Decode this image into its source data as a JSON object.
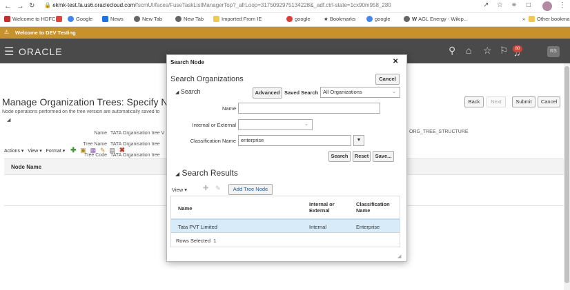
{
  "browser": {
    "url_host": "ekmk-test.fa.us6.oraclecloud.com",
    "url_path": "/fscmUI/faces/FuseTaskListManagerTop?_afrLoop=317509297513422​8&_adf.ctrl-state=1cx90m958_280",
    "bookmarks": [
      "Welcome to HDFC...",
      "Gmail",
      "Google",
      "News",
      "New Tab",
      "New Tab",
      "Imported From IE",
      "google",
      "Bookmarks",
      "google",
      "AGL Energy - Wikip..."
    ],
    "other_bookmarks": "Other bookmarks",
    "overflow": "»"
  },
  "dev_banner": "Welcome to DEV Testing",
  "oracle": {
    "logo": "ORACLE",
    "notification_count": "80",
    "user_initials": "RS"
  },
  "page": {
    "title": "Manage Organization Trees: Specify Nodes",
    "subtitle": "Node operations performed on the tree version are automatically saved to",
    "fields": [
      {
        "label": "Name",
        "value": "TATA Organisation tree V"
      },
      {
        "label": "Tree Name",
        "value": "TATA Organisation tree"
      },
      {
        "label": "Tree Code",
        "value": "TATA Organisation tree"
      }
    ],
    "right_value": "ORG_TREE_STRUCTURE",
    "buttons": {
      "back": "Back",
      "next": "Next",
      "submit": "Submit",
      "cancel": "Cancel"
    },
    "toolbar": {
      "actions": "Actions",
      "view": "View",
      "format": "Format"
    },
    "table_header": "Node Name"
  },
  "modal": {
    "title": "Search Node",
    "heading": "Search Organizations",
    "cancel": "Cancel",
    "search_section": "Search",
    "advanced": "Advanced",
    "saved_search_label": "Saved Search",
    "saved_search_value": "All Organizations",
    "labels": {
      "name": "Name",
      "internal_external": "Internal or External",
      "classification": "Classification Name"
    },
    "values": {
      "name": "",
      "internal_external": "",
      "classification": "enterprise"
    },
    "buttons": {
      "search": "Search",
      "reset": "Reset",
      "save": "Save..."
    },
    "results_section": "Search Results",
    "view": "View",
    "add_tree_node": "Add Tree Node",
    "columns": {
      "name": "Name",
      "internal_external": "Internal or External",
      "classification": "Classification Name"
    },
    "rows": [
      {
        "name": "Tata PVT Limited",
        "internal_external": "Internal",
        "classification": "Enterprise"
      }
    ],
    "rows_selected_label": "Rows Selected",
    "rows_selected_count": "1"
  }
}
